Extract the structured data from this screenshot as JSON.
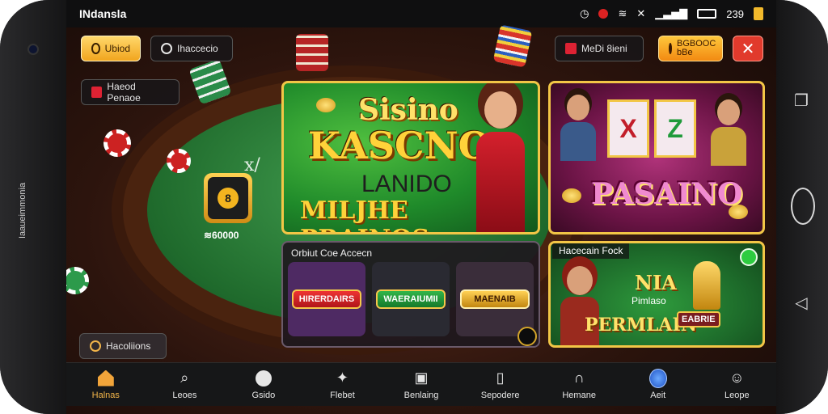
{
  "device": {
    "side_text": "Iaaueimmonia"
  },
  "statusbar": {
    "carrier": "INdansla",
    "time": "239"
  },
  "top": {
    "gold_button": "Ubiod",
    "history_button": "Ihaccecio",
    "rooms_button": "Haeod Penaoe",
    "menu_button": "MeDi 8ieni",
    "deposit_button_line1": "BGBOOC",
    "deposit_button_line2": "bBe",
    "close_symbol": "✕",
    "notifications_button": "Hacoliions"
  },
  "table": {
    "chip_letter": "8",
    "bet_amount": "≋60000",
    "felt_text": "x/"
  },
  "banners": {
    "main": {
      "line1": "Sisino",
      "line2": "KASCNO",
      "line3": "LANIDO",
      "line4": "MILJHE PRAINOS"
    },
    "slots": {
      "reel1": "X",
      "reel2": "Z",
      "title": "PASAINO"
    },
    "games_panel": {
      "title": "Orbiut Coe Accecn",
      "tiles": [
        {
          "label": "HIRERDAIRS"
        },
        {
          "label": "WAERAIUMII"
        },
        {
          "label": "MAENAIB"
        }
      ]
    },
    "promo": {
      "title": "Hacecain Fock",
      "headline": "NIA",
      "sub": "Pimlaso",
      "main": "PERMLAIN",
      "side": "EABRIE"
    }
  },
  "tabbar": {
    "items": [
      {
        "label": "Halnas",
        "active": true
      },
      {
        "label": "Leoes"
      },
      {
        "label": "Gsido"
      },
      {
        "label": "Flebet"
      },
      {
        "label": "Benlaing"
      },
      {
        "label": "Sepodere"
      },
      {
        "label": "Hemane"
      },
      {
        "label": "Aeit"
      },
      {
        "label": "Leope"
      }
    ]
  },
  "colors": {
    "accent_gold": "#f2c646",
    "close_red": "#e13a2c",
    "felt_green": "#1f6a2c"
  }
}
